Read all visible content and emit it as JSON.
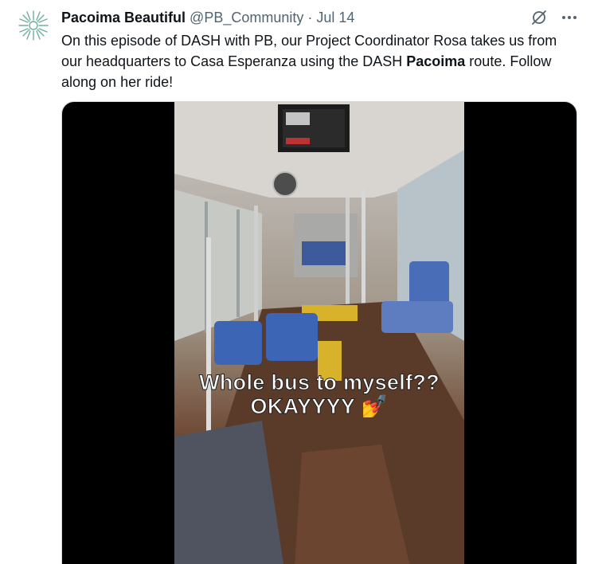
{
  "tweet": {
    "display_name": "Pacoima Beautiful",
    "handle": "@PB_Community",
    "separator": "·",
    "date": "Jul 14",
    "text_before_bold": "On this episode of DASH with PB, our Project Coordinator Rosa takes us from our headquarters to Casa Esperanza using the DASH ",
    "text_bold": "Pacoima",
    "text_after_bold": " route. Follow along on her ride!"
  },
  "media": {
    "caption_line1": "Whole bus to myself??",
    "caption_line2": "OKAYYYY 💅"
  },
  "icons": {
    "avatar": "sunburst-logo-icon",
    "grok": "grok-icon",
    "more": "more-icon"
  },
  "colors": {
    "text": "#0f1419",
    "secondary": "#536471",
    "avatar": "#6fae9b"
  }
}
